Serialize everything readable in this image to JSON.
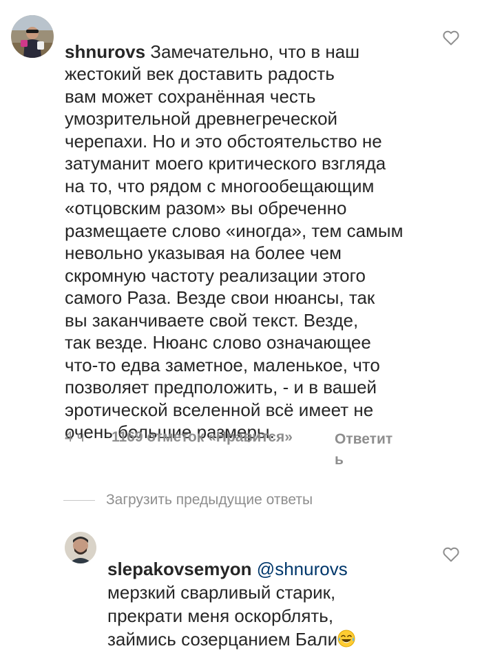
{
  "comment_main": {
    "username": "shnurovs",
    "text_lines": [
      "Замечательно, что в наш",
      "жестокий век доставить радость",
      "вам может сохранённая честь",
      "умозрительной древнегреческой",
      "черепахи. Но и это обстоятельство не",
      "затуманит моего критического взгляда",
      "на то, что рядом с  многообещающим",
      "«отцовским разом» вы обреченно",
      "размещаете слово «иногда», тем самым",
      "невольно указывая на более чем",
      "скромную частоту реализации этого",
      "самого Раза. Везде свои нюансы, так",
      "вы заканчиваете свой текст. Везде,",
      "так везде. Нюанс слово означающее",
      "что-то  едва заметное, маленькое, что",
      "позволяет предположить, - и в вашей",
      "эротической вселенной всё имеет не",
      "очень большие размеры."
    ],
    "time": "4 ч",
    "likes": "1169 отметок «Нравится»",
    "reply_label": "Ответить",
    "avatar_icon": "user-avatar-photo",
    "like_icon": "heart-outline-icon"
  },
  "load_previous": {
    "label": "Загрузить предыдущие ответы"
  },
  "reply_comment": {
    "username": "slepakovsemyon",
    "mention": "@shnurovs",
    "text_lines": [
      "мерзкий сварливый старик,",
      "прекрати меня оскорблять,",
      "займись созерцанием Бали"
    ],
    "emoji": "face-with-tears-of-joy",
    "avatar_icon": "user-avatar-photo",
    "like_icon": "heart-outline-icon"
  },
  "colors": {
    "text": "#262626",
    "secondary": "#8e8e8e",
    "mention": "#00376b",
    "divider": "#c7c7c7"
  }
}
